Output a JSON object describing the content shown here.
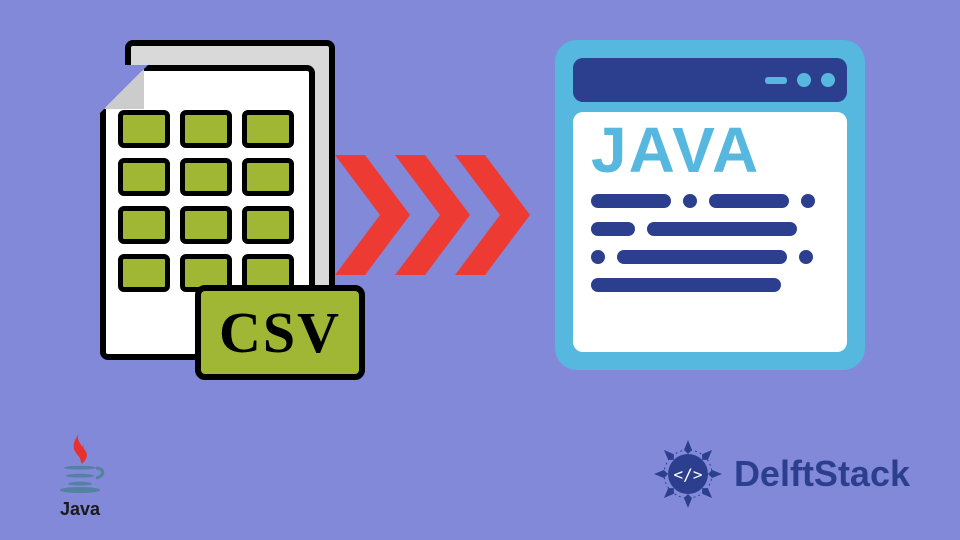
{
  "csv": {
    "badge_label": "CSV"
  },
  "arrows": {
    "count": 3,
    "color": "#ed3b33"
  },
  "java_window": {
    "title": "JAVA",
    "titlebar_controls": [
      "dash",
      "dot",
      "dot"
    ]
  },
  "bottom_left_logo": {
    "label": "Java"
  },
  "bottom_right_logo": {
    "label": "DelftStack"
  },
  "colors": {
    "background": "#8289d9",
    "accent_green": "#9fb734",
    "arrow_red": "#ed3b33",
    "window_cyan": "#57b8df",
    "deep_blue": "#2c3f8f"
  }
}
